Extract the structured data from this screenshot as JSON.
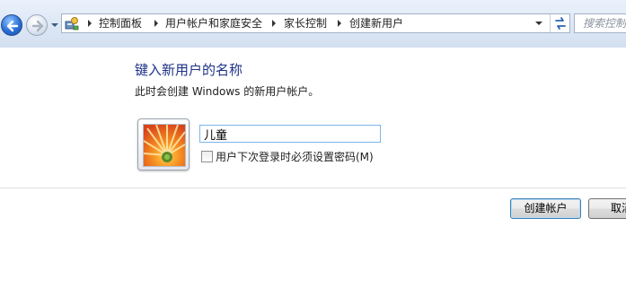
{
  "address_bar": {
    "breadcrumbs": [
      "控制面板",
      "用户帐户和家庭安全",
      "家长控制",
      "创建新用户"
    ],
    "search_placeholder": "搜索控制面板"
  },
  "main": {
    "title": "键入新用户的名称",
    "description": "此时会创建 Windows 的新用户帐户。",
    "name_value": "儿童",
    "password_checkbox_label": "用户下次登录时必须设置密码(M)",
    "password_checkbox_checked": false
  },
  "buttons": {
    "create": "创建帐户",
    "cancel": "取消"
  },
  "colors": {
    "title": "#1e3287",
    "nav_background": "#dce7f5",
    "input_focus_border": "#7eb4ea"
  }
}
